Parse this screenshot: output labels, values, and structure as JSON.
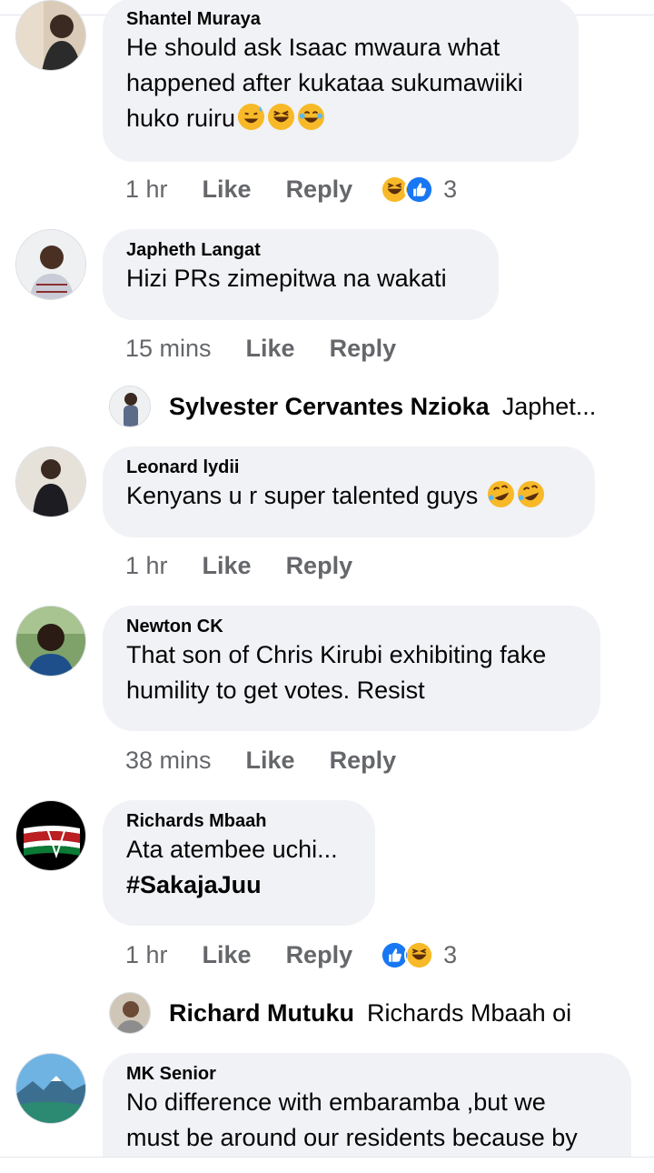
{
  "comments": [
    {
      "author": "Shantel Muraya",
      "lines": [
        "He should ask Isaac mwaura what",
        "happened after kukataa sukumawiiki",
        "huko ruiru"
      ],
      "time": "1 hr",
      "like_label": "Like",
      "reply_label": "Reply",
      "reaction_count": "3",
      "reactions": [
        "haha",
        "like"
      ]
    },
    {
      "author": "Japheth Langat",
      "lines": [
        "Hizi  PRs zimepitwa na wakati"
      ],
      "time": "15 mins",
      "like_label": "Like",
      "reply_label": "Reply",
      "reply_preview": {
        "name": "Sylvester Cervantes Nzioka",
        "text": "Japhet..."
      }
    },
    {
      "author": "Leonard lydii",
      "lines": [
        "Kenyans u r super talented guys"
      ],
      "time": "1 hr",
      "like_label": "Like",
      "reply_label": "Reply"
    },
    {
      "author": "Newton CK",
      "lines": [
        "That son of Chris Kirubi exhibiting fake",
        "humility to get votes. Resist"
      ],
      "time": "38 mins",
      "like_label": "Like",
      "reply_label": "Reply"
    },
    {
      "author": "Richards Mbaah",
      "lines": [
        "Ata atembee uchi...",
        "#SakajaJuu"
      ],
      "time": "1 hr",
      "like_label": "Like",
      "reply_label": "Reply",
      "reaction_count": "3",
      "reactions": [
        "like",
        "haha"
      ],
      "reply_preview": {
        "name": "Richard Mutuku",
        "text": "Richards Mbaah oi"
      }
    },
    {
      "author": "MK Senior",
      "lines": [
        "No difference with embaramba ,but we",
        "must be around our residents because by"
      ]
    }
  ],
  "colors": {
    "bubble": "#f0f2f5",
    "meta": "#65676b",
    "like_blue": "#1877f2",
    "haha_yellow": "#f7b928"
  }
}
